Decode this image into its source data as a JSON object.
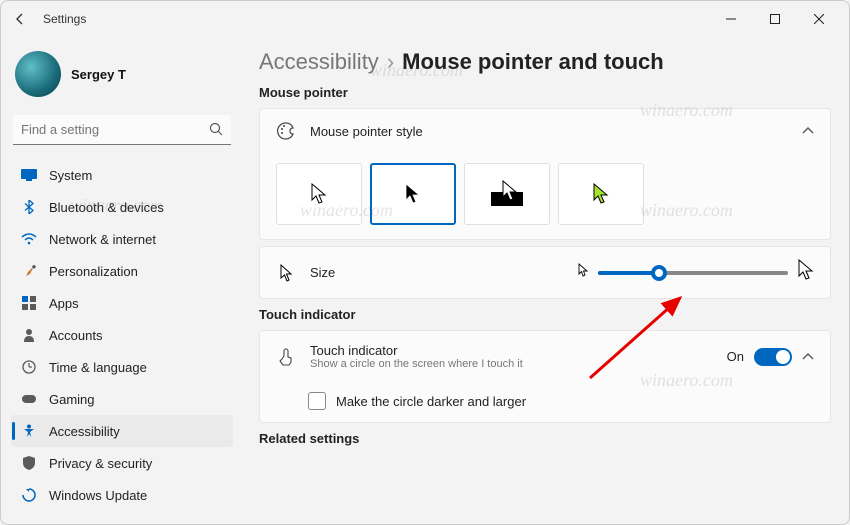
{
  "window": {
    "title": "Settings"
  },
  "user": {
    "name": "Sergey T"
  },
  "search": {
    "placeholder": "Find a setting"
  },
  "nav": {
    "items": [
      {
        "label": "System"
      },
      {
        "label": "Bluetooth & devices"
      },
      {
        "label": "Network & internet"
      },
      {
        "label": "Personalization"
      },
      {
        "label": "Apps"
      },
      {
        "label": "Accounts"
      },
      {
        "label": "Time & language"
      },
      {
        "label": "Gaming"
      },
      {
        "label": "Accessibility"
      },
      {
        "label": "Privacy & security"
      },
      {
        "label": "Windows Update"
      }
    ],
    "active_index": 8
  },
  "breadcrumb": {
    "parent": "Accessibility",
    "title": "Mouse pointer and touch"
  },
  "sections": {
    "mouse_pointer": {
      "title": "Mouse pointer",
      "style_card": {
        "label": "Mouse pointer style",
        "selected_index": 1
      },
      "size_card": {
        "label": "Size",
        "value_percent": 32
      }
    },
    "touch": {
      "title": "Touch indicator",
      "touch_card": {
        "label": "Touch indicator",
        "sub": "Show a circle on the screen where I touch it",
        "state_label": "On",
        "on": true
      },
      "option": {
        "label": "Make the circle darker and larger",
        "checked": false
      }
    },
    "related": {
      "title": "Related settings"
    }
  },
  "watermark": "winaero.com"
}
